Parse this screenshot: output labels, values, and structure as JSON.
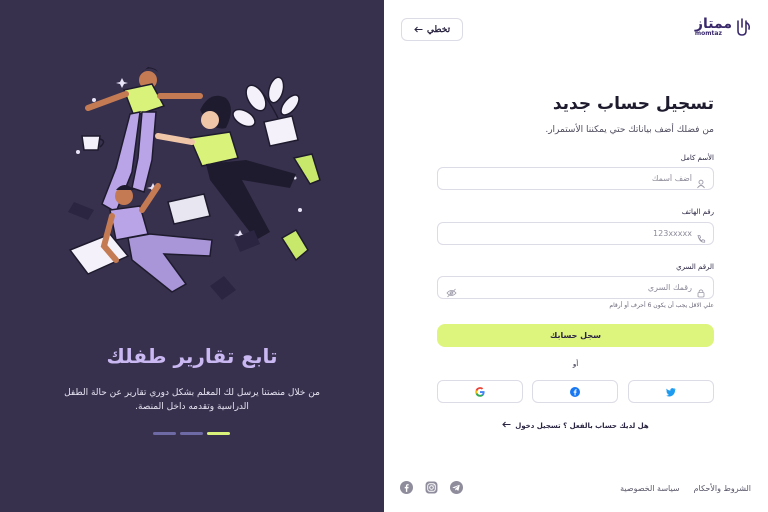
{
  "brand": {
    "name_ar": "ممتاز",
    "name_en": "momtaz"
  },
  "header": {
    "skip_label": "تخطي"
  },
  "hero": {
    "title": "تابع تقارير طفلك",
    "description": "من خلال منصتنا يرسل لك المعلم بشكل دوري تقارير عن حالة الطفل الدراسية وتقدمه داخل المنصة.",
    "slides_total": 3,
    "active_slide": 1
  },
  "form": {
    "title": "تسجيل حساب جديد",
    "subtitle": "من فضلك أضف بياناتك حتي يمكننا الأستمرار.",
    "full_name": {
      "label": "الأسم كامل",
      "placeholder": "أضف أسمك",
      "value": ""
    },
    "phone": {
      "label": "رقم الهاتف",
      "placeholder": "123xxxxx",
      "value": ""
    },
    "password": {
      "label": "الرقم السري",
      "placeholder": "رقمك السري",
      "value": "",
      "hint": "علي الاقل يجب أن يكون 6 أحرف أو أرقام"
    },
    "submit_label": "سجل حسابك",
    "or_label": "أو",
    "social_icons": [
      "twitter-icon",
      "facebook-icon",
      "google-icon"
    ],
    "have_account_text": "هل لديك حساب بالفعل ؟ تسجيل دخول"
  },
  "footer": {
    "terms_label": "الشروط والأحكام",
    "privacy_label": "سياسة الخصوصية",
    "social_icons": [
      "telegram-icon",
      "instagram-icon",
      "facebook-icon"
    ]
  },
  "colors": {
    "panel_bg": "#38314e",
    "accent_lime": "#ddf47d",
    "hero_title": "#c9b8f2",
    "brand_purple": "#3a2a6c"
  }
}
